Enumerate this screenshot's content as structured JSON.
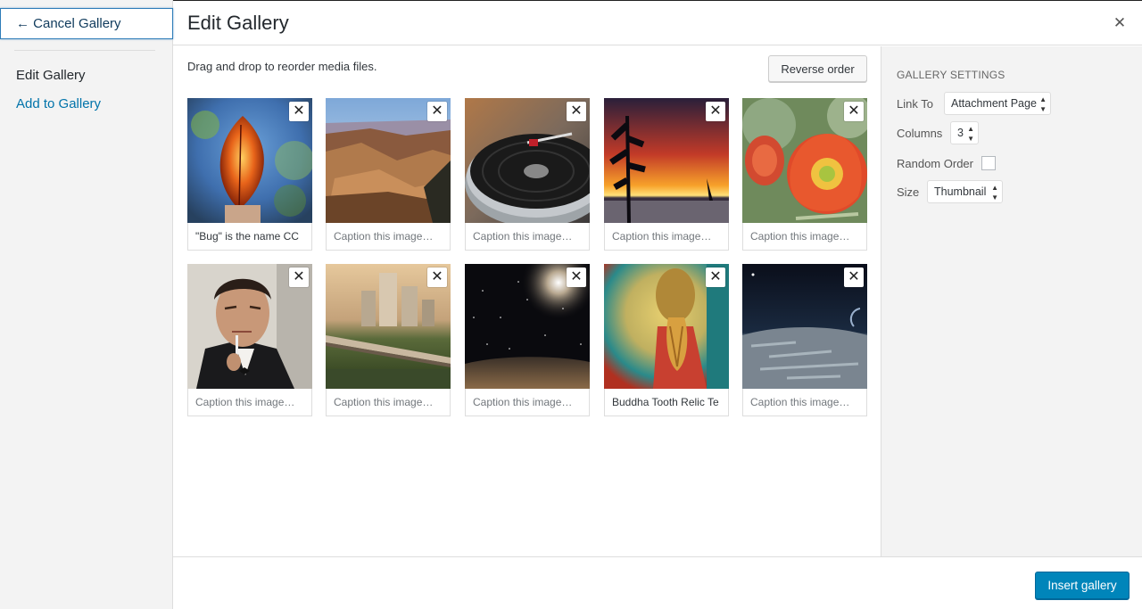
{
  "sidebar": {
    "cancel_label": "← Cancel Gallery",
    "items": [
      {
        "label": "Edit Gallery"
      },
      {
        "label": "Add to Gallery"
      }
    ]
  },
  "header": {
    "title": "Edit Gallery",
    "close_icon": "close-icon"
  },
  "main": {
    "instructions": "Drag and drop to reorder media files.",
    "reverse_label": "Reverse order",
    "caption_placeholder": "Caption this image…",
    "tiles": [
      {
        "image": "glowing orange leaf on blue background",
        "caption": "\"Bug\" is the name CC"
      },
      {
        "image": "canyon landscape",
        "caption": ""
      },
      {
        "image": "vinyl record turntable",
        "caption": ""
      },
      {
        "image": "sunset behind tree silhouette",
        "caption": ""
      },
      {
        "image": "red cactus flower",
        "caption": ""
      },
      {
        "image": "man in tuxedo with cigarette",
        "caption": ""
      },
      {
        "image": "city bridge tilt-shift",
        "caption": ""
      },
      {
        "image": "starry space galaxy",
        "caption": ""
      },
      {
        "image": "golden buddha hands",
        "caption": "Buddha Tooth Relic Te"
      },
      {
        "image": "planet surface from space",
        "caption": ""
      }
    ]
  },
  "settings": {
    "heading": "GALLERY SETTINGS",
    "link_to_label": "Link To",
    "link_to_value": "Attachment Page",
    "columns_label": "Columns",
    "columns_value": "3",
    "random_order_label": "Random Order",
    "random_order_checked": false,
    "size_label": "Size",
    "size_value": "Thumbnail"
  },
  "toolbar": {
    "insert_label": "Insert gallery"
  },
  "colors": {
    "accent": "#0085ba",
    "link": "#0073aa"
  }
}
